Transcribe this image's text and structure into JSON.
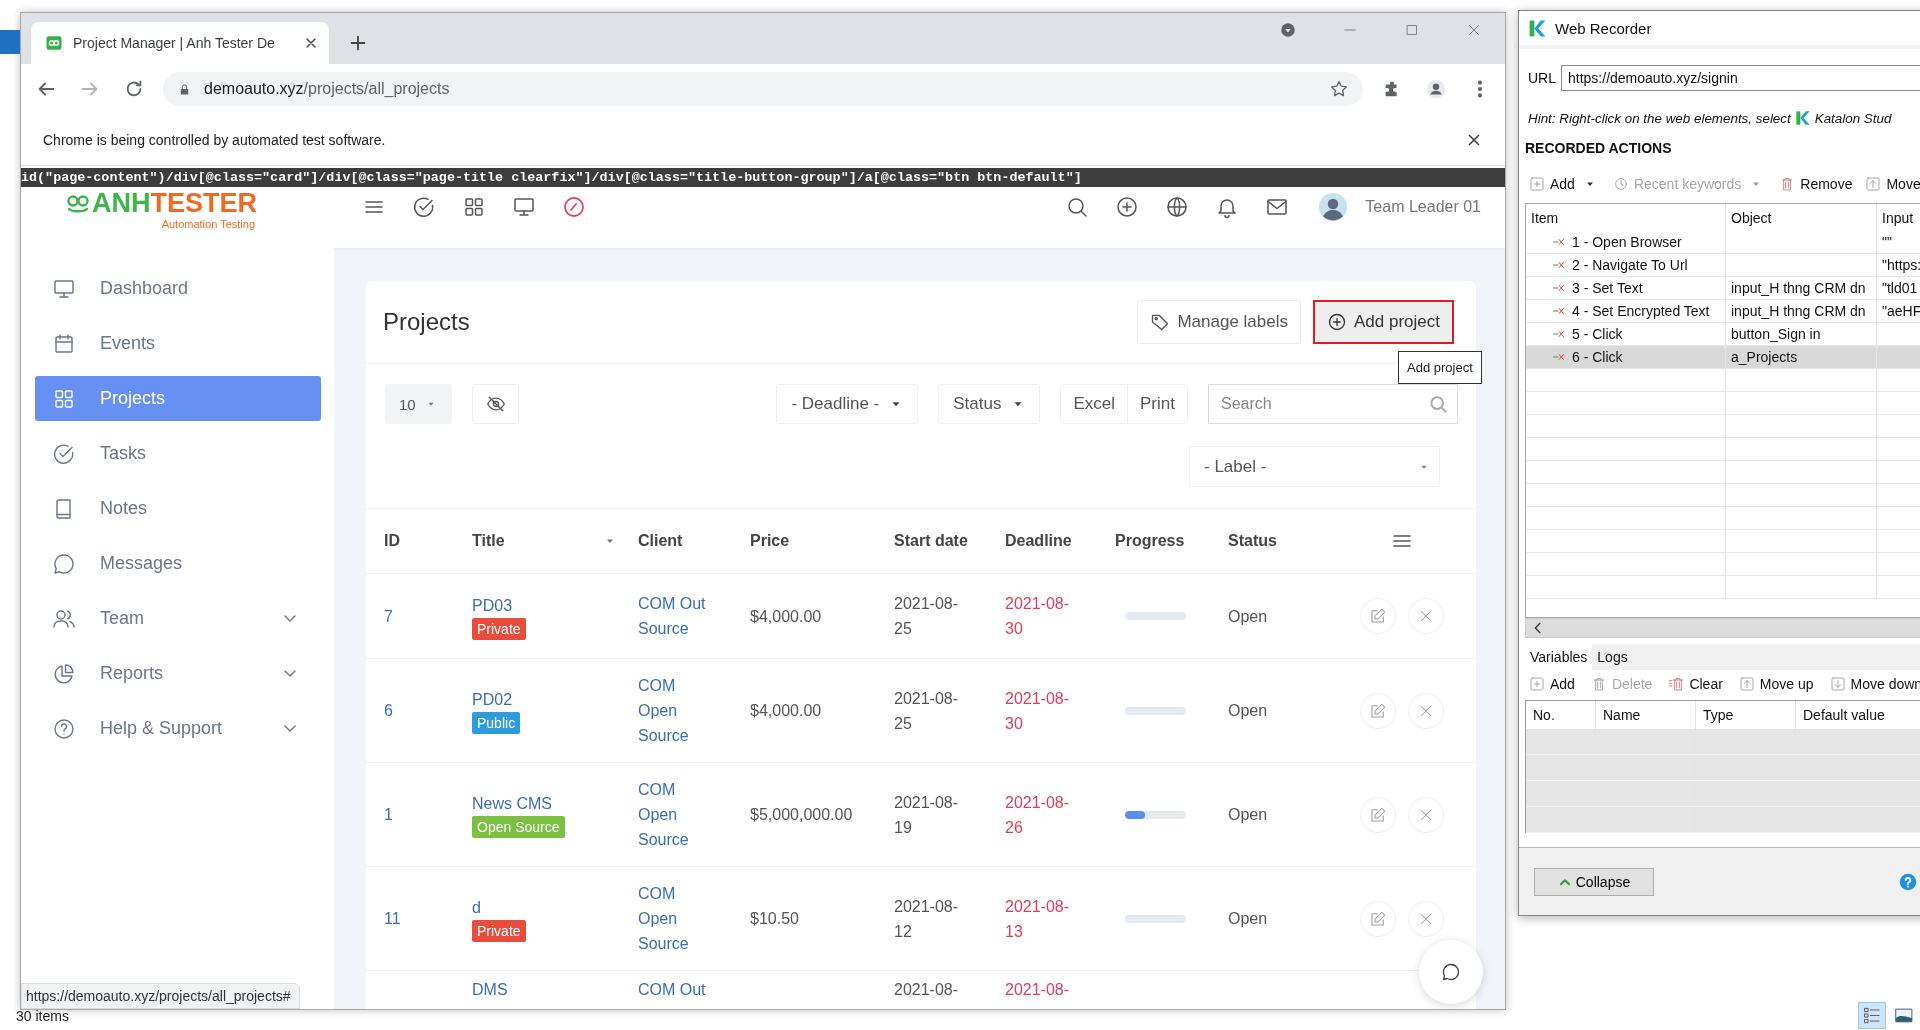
{
  "desktop": {
    "status_count": "30 items",
    "view_buttons": [
      {
        "selected": true
      },
      {
        "selected": false
      }
    ]
  },
  "browser": {
    "tab_title": "Project Manager | Anh Tester De",
    "url_host": "demoauto.xyz",
    "url_path": "/projects/all_projects",
    "infobar": "Chrome is being controlled by automated test software.",
    "xpath": "id(\"page-content\")/div[@class=\"card\"]/div[@class=\"page-title clearfix\"]/div[@class=\"title-button-group\"]/a[@class=\"btn btn-default\"]",
    "link_preview": "https://demoauto.xyz/projects/all_projects#"
  },
  "app": {
    "logo": {
      "first": "ANH",
      "second": "TESTER",
      "tagline": "Automation Testing"
    },
    "user": "Team Leader 01"
  },
  "sidebar": {
    "items": [
      {
        "label": "Dashboard",
        "selected": false,
        "has_submenu": false
      },
      {
        "label": "Events",
        "selected": false,
        "has_submenu": false
      },
      {
        "label": "Projects",
        "selected": true,
        "has_submenu": false
      },
      {
        "label": "Tasks",
        "selected": false,
        "has_submenu": false
      },
      {
        "label": "Notes",
        "selected": false,
        "has_submenu": false
      },
      {
        "label": "Messages",
        "selected": false,
        "has_submenu": false
      },
      {
        "label": "Team",
        "selected": false,
        "has_submenu": true
      },
      {
        "label": "Reports",
        "selected": false,
        "has_submenu": true
      },
      {
        "label": "Help & Support",
        "selected": false,
        "has_submenu": true
      }
    ]
  },
  "projects": {
    "title": "Projects",
    "actions": [
      {
        "label": "Manage labels",
        "kind": "labels",
        "highlighted": false
      },
      {
        "label": "Add project",
        "kind": "add",
        "highlighted": true
      }
    ],
    "tooltip": "Add project",
    "page_size": "10",
    "filters": [
      "- Deadline -",
      "Status"
    ],
    "exports": [
      "Excel",
      "Print"
    ],
    "search": {
      "placeholder": "Search"
    },
    "label_filter": "- Label -",
    "table": {
      "columns": [
        {
          "label": "ID",
          "sortable": false
        },
        {
          "label": "Title",
          "sortable": true
        },
        {
          "label": "Client",
          "sortable": false
        },
        {
          "label": "Price",
          "sortable": false
        },
        {
          "label": "Start date",
          "sortable": false
        },
        {
          "label": "Deadline",
          "sortable": false
        },
        {
          "label": "Progress",
          "sortable": false
        },
        {
          "label": "Status",
          "sortable": false
        }
      ],
      "rows": [
        {
          "id": "7",
          "title": "PD03",
          "badge": {
            "text": "Private",
            "color": "#e74c3c"
          },
          "client": "COM Out Source",
          "price": "$4,000.00",
          "start_date": "2021-08-25",
          "deadline": "2021-08-30",
          "level": 0,
          "status": "Open"
        },
        {
          "id": "6",
          "title": "PD02",
          "badge": {
            "text": "Public",
            "color": "#2d9cdb"
          },
          "client": "COM Open Source",
          "price": "$4,000.00",
          "start_date": "2021-08-25",
          "deadline": "2021-08-30",
          "level": 0,
          "status": "Open"
        },
        {
          "id": "1",
          "title": "News CMS",
          "badge": {
            "text": "Open Source",
            "color": "#7ac142"
          },
          "client": "COM Open Source",
          "price": "$5,000,000.00",
          "start_date": "2021-08-19",
          "deadline": "2021-08-26",
          "level": 0.33,
          "status": "Open"
        },
        {
          "id": "11",
          "title": "d",
          "badge": {
            "text": "Private",
            "color": "#e74c3c"
          },
          "client": "COM Open Source",
          "price": "$10.50",
          "start_date": "2021-08-12",
          "deadline": "2021-08-13",
          "level": 0,
          "status": "Open"
        },
        {
          "title": "DMS",
          "client": "COM Out",
          "start_date": "2021-08-",
          "deadline": "2021-08-"
        }
      ]
    }
  },
  "recorder": {
    "title": "Web Recorder",
    "url_label": "URL",
    "url": "https://demoauto.xyz/signin",
    "hint": "Hint: Right-click on the web elements, select",
    "hint_app": "Katalon Stud",
    "heading": "RECORDED ACTIONS",
    "toolbar": [
      {
        "label": "Add",
        "disabled": false,
        "dropdown": true
      },
      {
        "label": "Recent keywords",
        "disabled": true,
        "dropdown": true
      },
      {
        "label": "Remove",
        "disabled": false,
        "dropdown": false
      },
      {
        "label": "Move",
        "disabled": false,
        "dropdown": false
      }
    ],
    "columns": [
      "Item",
      "Object",
      "Input"
    ],
    "actions": [
      {
        "item": "1 - Open Browser",
        "input": "\"\"",
        "selected": false
      },
      {
        "item": "2 - Navigate To Url",
        "input": "\"https:",
        "selected": false
      },
      {
        "item": "3 - Set Text",
        "object": "input_H thng CRM dn",
        "input": "\"tld01",
        "selected": false
      },
      {
        "item": "4 - Set Encrypted Text",
        "object": "input_H thng CRM dn",
        "input": "\"aeHF",
        "selected": false
      },
      {
        "item": "5 - Click",
        "object": "button_Sign in",
        "selected": false
      },
      {
        "item": "6 - Click",
        "object": "a_Projects",
        "selected": true
      }
    ],
    "tabs": [
      {
        "label": "Variables",
        "selected": true
      },
      {
        "label": "Logs",
        "selected": false
      }
    ],
    "variable_toolbar": [
      {
        "label": "Add",
        "disabled": false
      },
      {
        "label": "Delete",
        "disabled": true
      },
      {
        "label": "Clear",
        "disabled": false
      },
      {
        "label": "Move up",
        "disabled": false
      },
      {
        "label": "Move down",
        "disabled": false
      }
    ],
    "variable_columns": [
      "No.",
      "Name",
      "Type",
      "Default value"
    ],
    "collapse": "Collapse"
  }
}
